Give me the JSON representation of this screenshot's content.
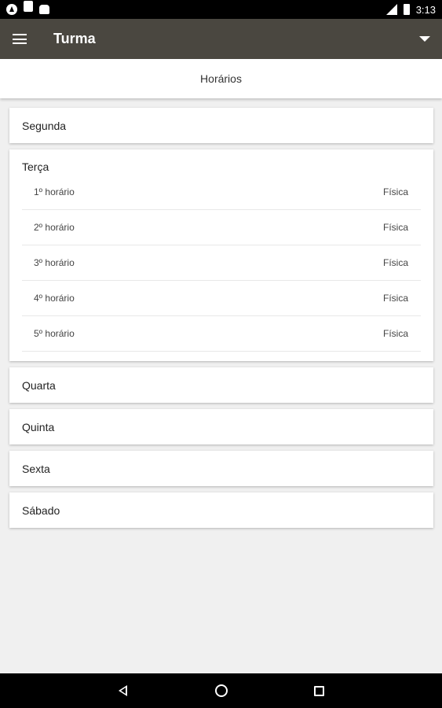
{
  "statusbar": {
    "time": "3:13",
    "icons": [
      "app-a-icon",
      "sd-card-icon",
      "android-icon",
      "signal-icon",
      "battery-icon"
    ]
  },
  "appbar": {
    "title": "Turma",
    "menu_icon": "hamburger-menu-icon",
    "dropdown_icon": "caret-down-icon",
    "background": "#4a4740"
  },
  "tab": {
    "label": "Horários"
  },
  "days": {
    "d0": {
      "label": "Segunda"
    },
    "d1": {
      "label": "Terça",
      "rows": [
        {
          "slot": "1º horário",
          "subject": "Física"
        },
        {
          "slot": "2º horário",
          "subject": "Física"
        },
        {
          "slot": "3º horário",
          "subject": "Física"
        },
        {
          "slot": "4º horário",
          "subject": "Física"
        },
        {
          "slot": "5º horário",
          "subject": "Física"
        }
      ]
    },
    "d2": {
      "label": "Quarta"
    },
    "d3": {
      "label": "Quinta"
    },
    "d4": {
      "label": "Sexta"
    },
    "d5": {
      "label": "Sábado"
    }
  },
  "navbar": {
    "icons": [
      "back-icon",
      "home-icon",
      "recents-icon"
    ]
  }
}
